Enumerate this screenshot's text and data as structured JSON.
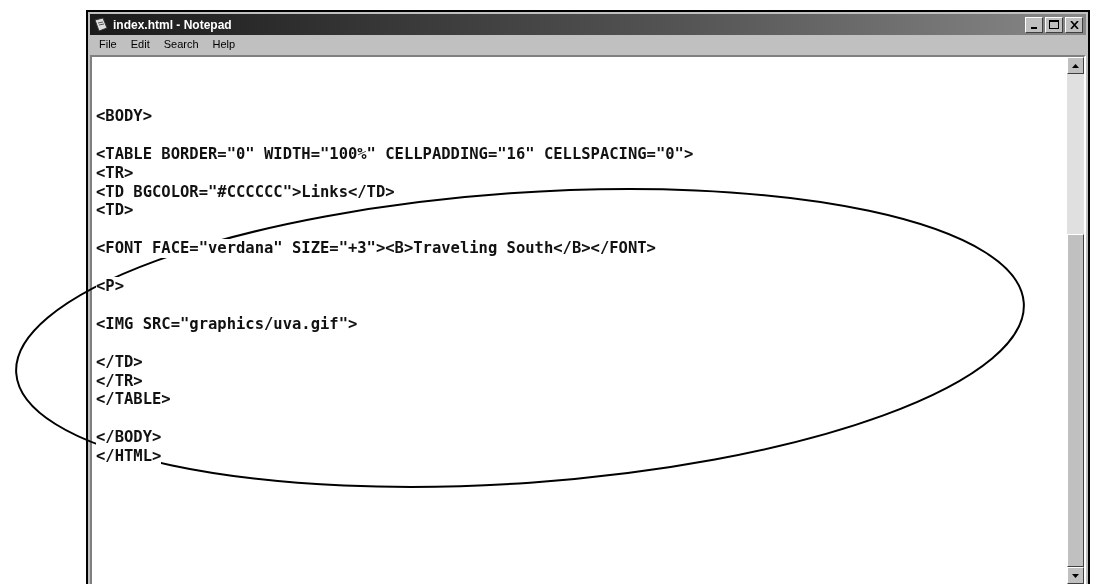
{
  "window": {
    "title": "index.html - Notepad"
  },
  "menu": [
    "File",
    "Edit",
    "Search",
    "Help"
  ],
  "lines": [
    {
      "kind": "blank"
    },
    {
      "kind": "code",
      "text": "<BODY>"
    },
    {
      "kind": "blank"
    },
    {
      "kind": "code",
      "text": "<TABLE BORDER=\"0\" WIDTH=\"100%\" CELLPADDING=\"16\" CELLSPACING=\"0\">"
    },
    {
      "kind": "code",
      "text": "<TR>"
    },
    {
      "kind": "code",
      "text": "<TD BGCOLOR=\"#CCCCCC\">Links</TD>"
    },
    {
      "kind": "code",
      "text": "<TD>"
    },
    {
      "kind": "blank"
    },
    {
      "kind": "code",
      "text": "<FONT FACE=\"verdana\" SIZE=\"+3\"><B>Traveling South</B></FONT>"
    },
    {
      "kind": "blank"
    },
    {
      "kind": "code",
      "text": "<P>"
    },
    {
      "kind": "blank"
    },
    {
      "kind": "code",
      "text": "<IMG SRC=\"graphics/uva.gif\">"
    },
    {
      "kind": "blank"
    },
    {
      "kind": "code",
      "text": "</TD>"
    },
    {
      "kind": "code",
      "text": "</TR>"
    },
    {
      "kind": "code",
      "text": "</TABLE>"
    },
    {
      "kind": "blank"
    },
    {
      "kind": "code",
      "text": "</BODY>"
    },
    {
      "kind": "code",
      "text": "</HTML>"
    }
  ]
}
